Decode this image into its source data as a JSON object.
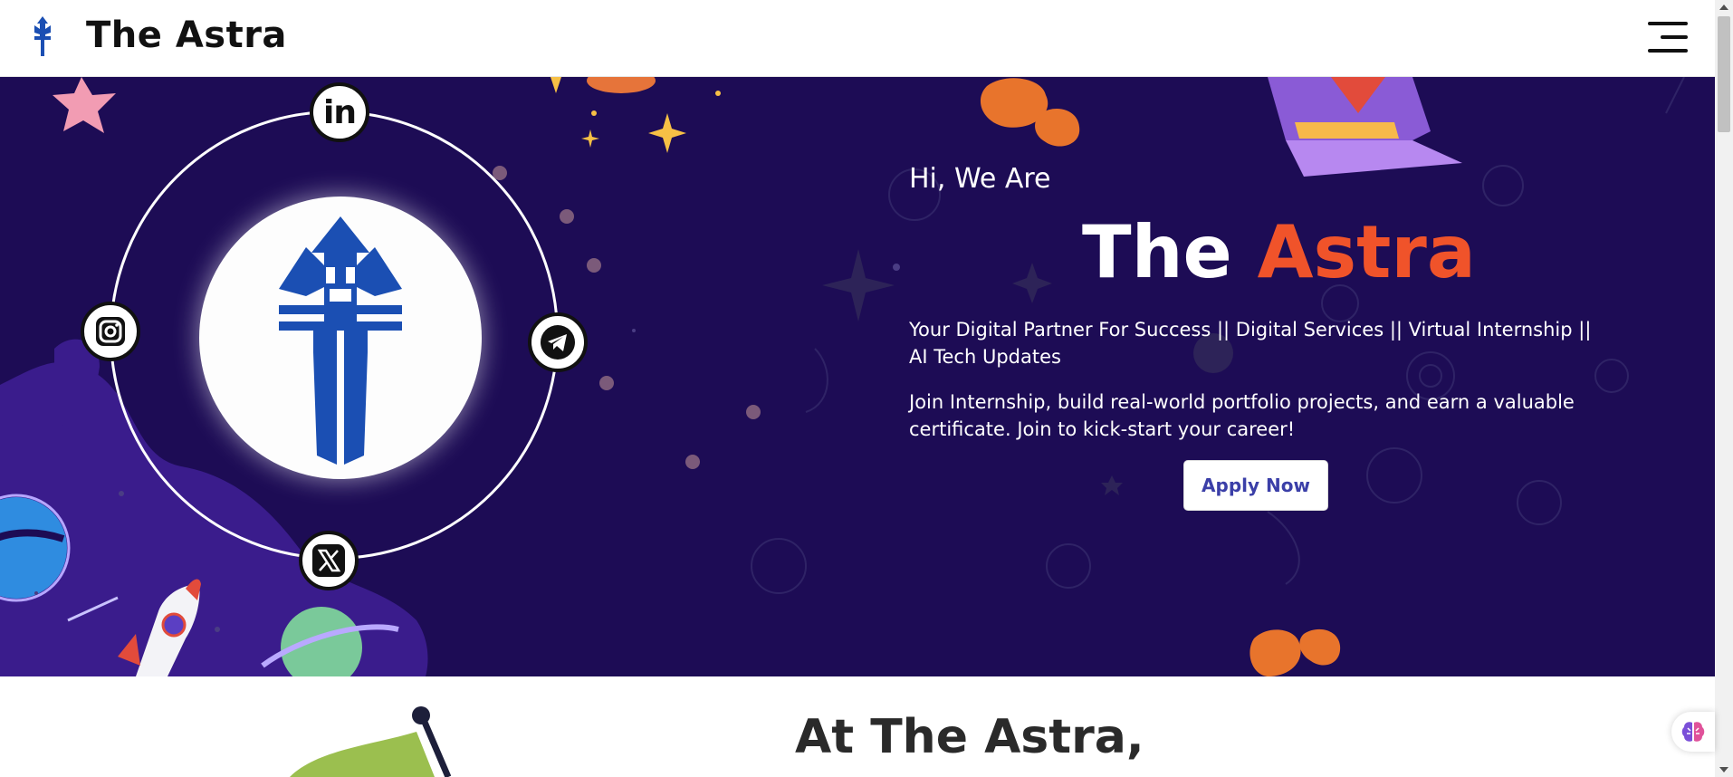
{
  "header": {
    "brand_title": "The Astra",
    "logo_icon": "astra-trident-icon",
    "menu_icon": "hamburger-menu-icon"
  },
  "hero": {
    "intro": "Hi, We Are",
    "title_part1": "The ",
    "title_part2": "Astra",
    "tagline": "Your Digital Partner For Success || Digital Services || Virtual Internship || AI Tech Updates",
    "description": "Join Internship, build real-world portfolio projects, and earn a valuable certificate. Join to kick-start your career!",
    "apply_label": "Apply Now",
    "social_links": [
      {
        "name": "linkedin",
        "label": "in",
        "icon": "linkedin-icon"
      },
      {
        "name": "instagram",
        "icon": "instagram-icon"
      },
      {
        "name": "telegram",
        "icon": "telegram-icon"
      },
      {
        "name": "twitter-x",
        "icon": "x-icon"
      }
    ]
  },
  "section2": {
    "title": "At The Astra,"
  },
  "colors": {
    "hero_background": "#1d0c55",
    "accent": "#f0532a",
    "button_text": "#3b3fa8",
    "logo_blue": "#1b4fb3"
  },
  "widget": {
    "icon": "ai-brain-icon"
  }
}
